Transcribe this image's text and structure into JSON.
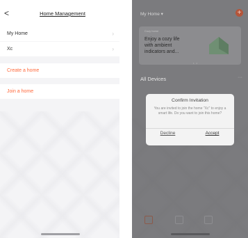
{
  "management": {
    "title": "Home Management",
    "homes": [
      {
        "label": "My Home"
      },
      {
        "label": "Xc"
      }
    ],
    "actions": {
      "create_label": "Create a home",
      "join_label": "Join a home"
    }
  },
  "home_screen": {
    "home_switch_label": "My Home ▾",
    "banner": {
      "tag": "Cozy home",
      "text": "Enjoy a cozy life\nwith ambient\nindicators and..."
    },
    "devices_title": "All Devices",
    "more": "···"
  },
  "dialog": {
    "title": "Confirm Invitation",
    "message": "You are invited to join the home \"Xc\" to enjoy a smart life. Do you want to join this home?",
    "decline_label": "Decline",
    "accept_label": "Accept"
  },
  "colors": {
    "accent": "#ff6a3d",
    "overlay_bg": "#7b7b7e",
    "panel_bg": "#f4f4f6"
  }
}
